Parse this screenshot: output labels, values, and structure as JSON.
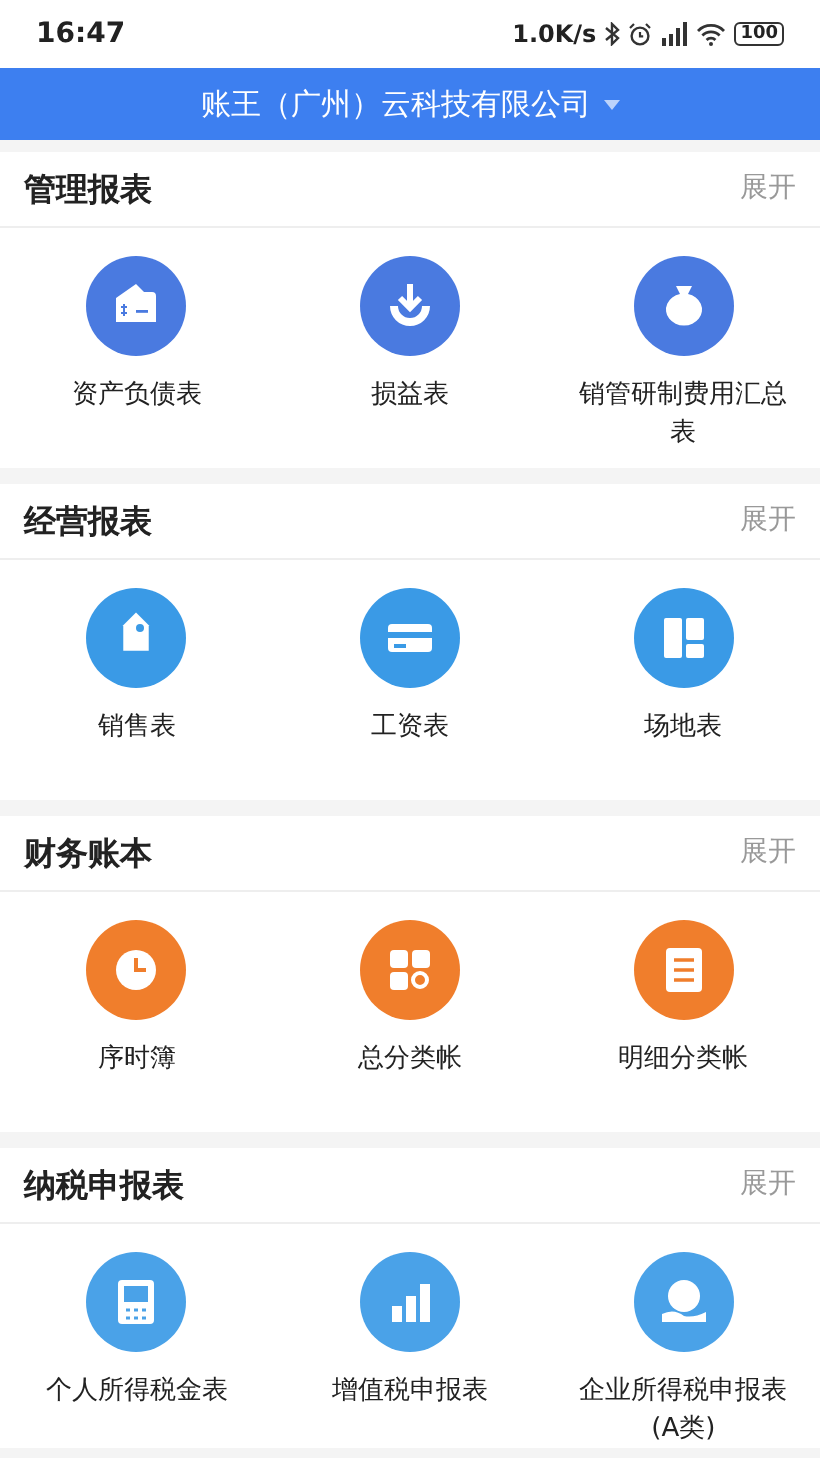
{
  "status_bar": {
    "time": "16:47",
    "speed": "1.0K/s",
    "battery": "100"
  },
  "header": {
    "title": "账王（广州）云科技有限公司"
  },
  "sections": [
    {
      "title": "管理报表",
      "action": "展开",
      "color": "#4a7ae0",
      "items": [
        {
          "label": "资产负债表",
          "kind": "wallet"
        },
        {
          "label": "损益表",
          "kind": "download"
        },
        {
          "label": "销管研制费用汇总表",
          "kind": "moneybag"
        }
      ]
    },
    {
      "title": "经营报表",
      "action": "展开",
      "color": "#3a9ae6",
      "items": [
        {
          "label": "销售表",
          "kind": "tag"
        },
        {
          "label": "工资表",
          "kind": "card"
        },
        {
          "label": "场地表",
          "kind": "layout"
        }
      ]
    },
    {
      "title": "财务账本",
      "action": "展开",
      "color": "#f07e2c",
      "items": [
        {
          "label": "序时簿",
          "kind": "clock"
        },
        {
          "label": "总分类帐",
          "kind": "grid"
        },
        {
          "label": "明细分类帐",
          "kind": "list"
        }
      ]
    },
    {
      "title": "纳税申报表",
      "action": "展开",
      "color": "#4aa2e8",
      "items": [
        {
          "label": "个人所得税金表",
          "kind": "calculator"
        },
        {
          "label": "增值税申报表",
          "kind": "bars"
        },
        {
          "label": "企业所得税申报表(A类)",
          "kind": "coinhand"
        }
      ]
    }
  ]
}
